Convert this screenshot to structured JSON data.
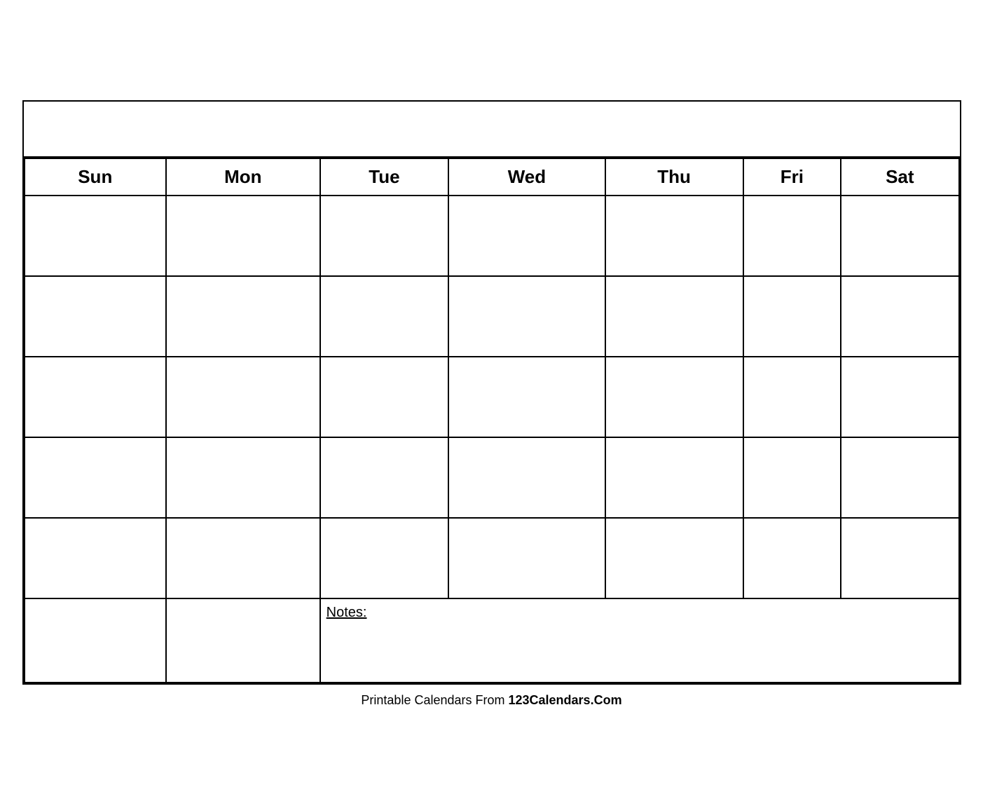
{
  "calendar": {
    "title": "",
    "days": {
      "sun": "Sun",
      "mon": "Mon",
      "tue": "Tue",
      "wed": "Wed",
      "thu": "Thu",
      "fri": "Fri",
      "sat": "Sat"
    },
    "notes_label": "Notes:",
    "rows": 5
  },
  "footer": {
    "text_plain": "Printable Calendars From ",
    "text_bold": "123Calendars.Com"
  }
}
